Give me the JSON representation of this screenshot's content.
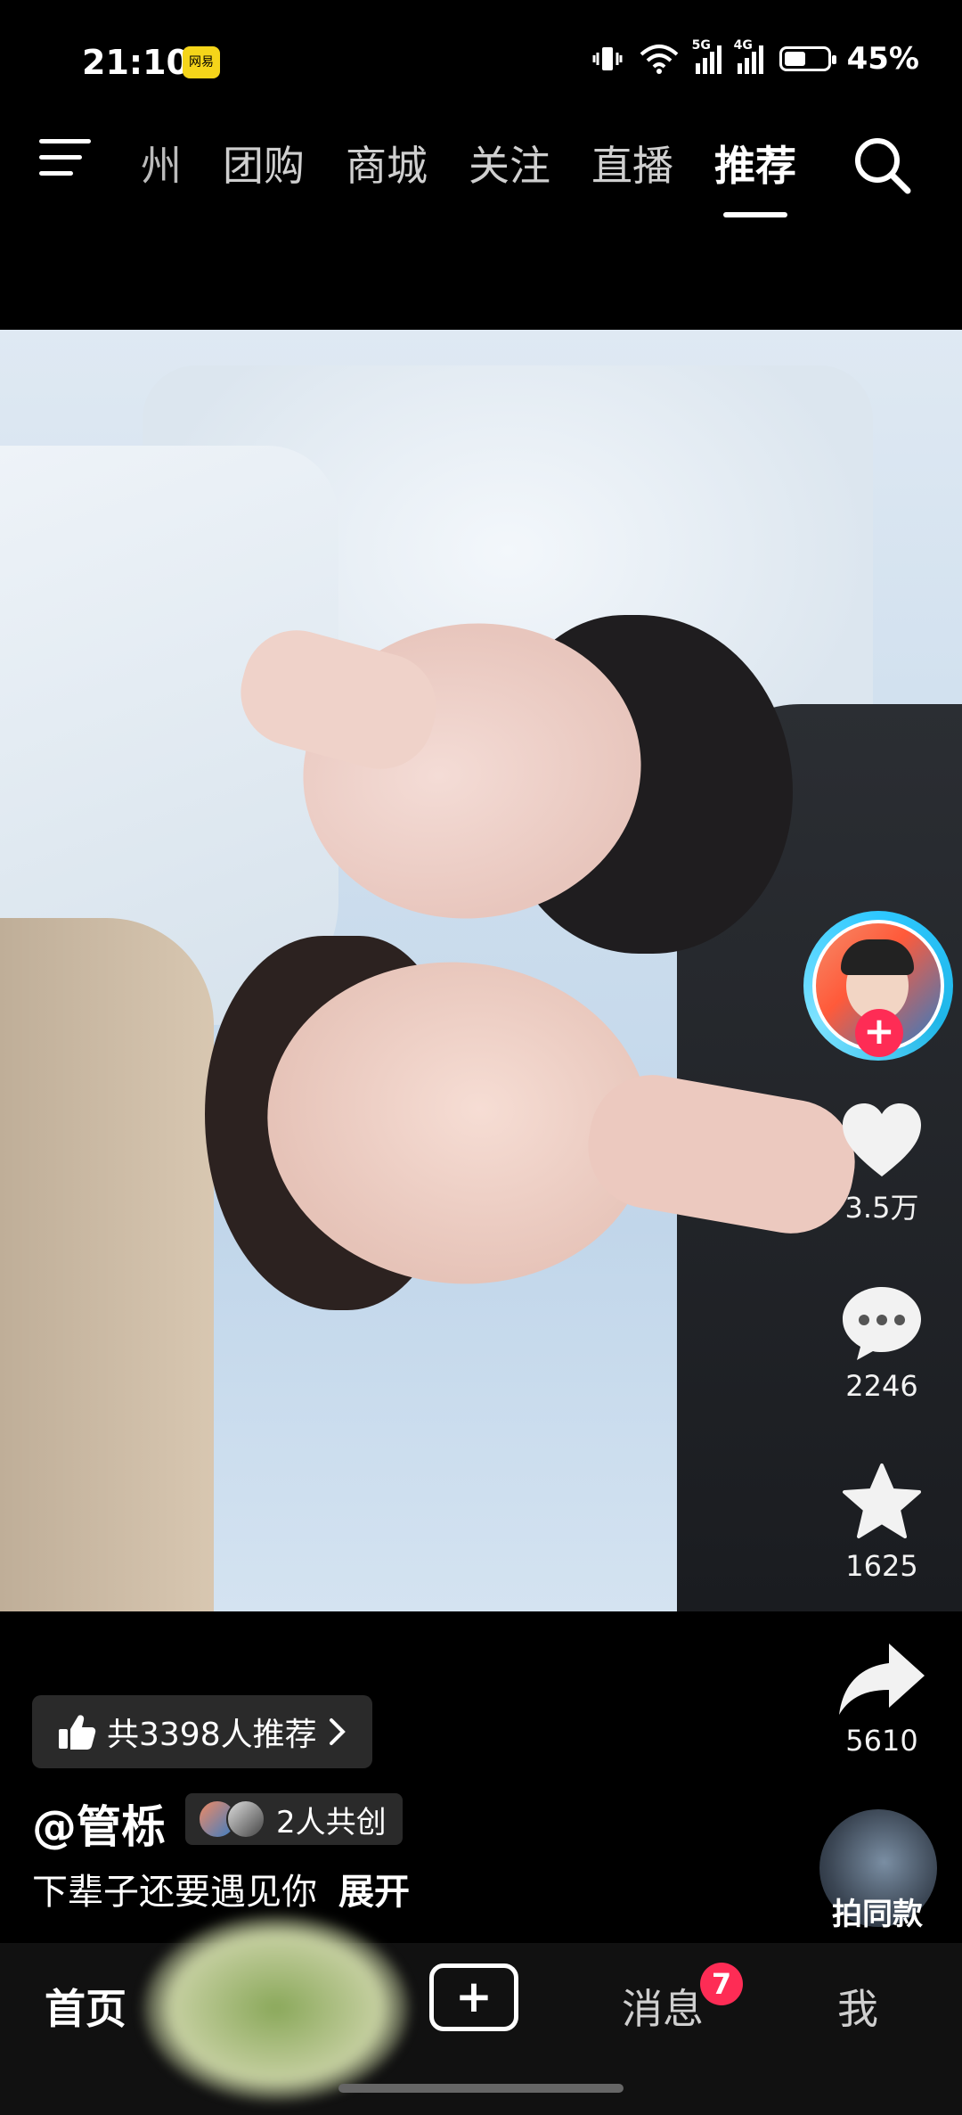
{
  "status": {
    "time": "21:10",
    "app_badge": "网易",
    "network1": "5G",
    "network2": "4G",
    "battery_percent_text": "45%",
    "battery_level": 0.45
  },
  "top_nav": {
    "tabs": [
      {
        "label": "州",
        "partial": true
      },
      {
        "label": "团购"
      },
      {
        "label": "商城"
      },
      {
        "label": "关注"
      },
      {
        "label": "直播"
      },
      {
        "label": "推荐",
        "active": true
      }
    ]
  },
  "actions": {
    "likes": "3.5万",
    "comments": "2246",
    "favorites": "1625",
    "shares": "5610",
    "remix_label": "拍同款"
  },
  "post": {
    "recommend_text": "共3398人推荐",
    "author": "@管栎",
    "cocreate_text": "2人共创",
    "caption": "下辈子还要遇见你",
    "expand_label": "展开"
  },
  "bottom_nav": {
    "home": "首页",
    "messages": "消息",
    "messages_badge": "7",
    "me": "我"
  },
  "colors": {
    "accent": "#fe2c55",
    "avatar_ring": "#2ec8ff",
    "background": "#000000"
  }
}
